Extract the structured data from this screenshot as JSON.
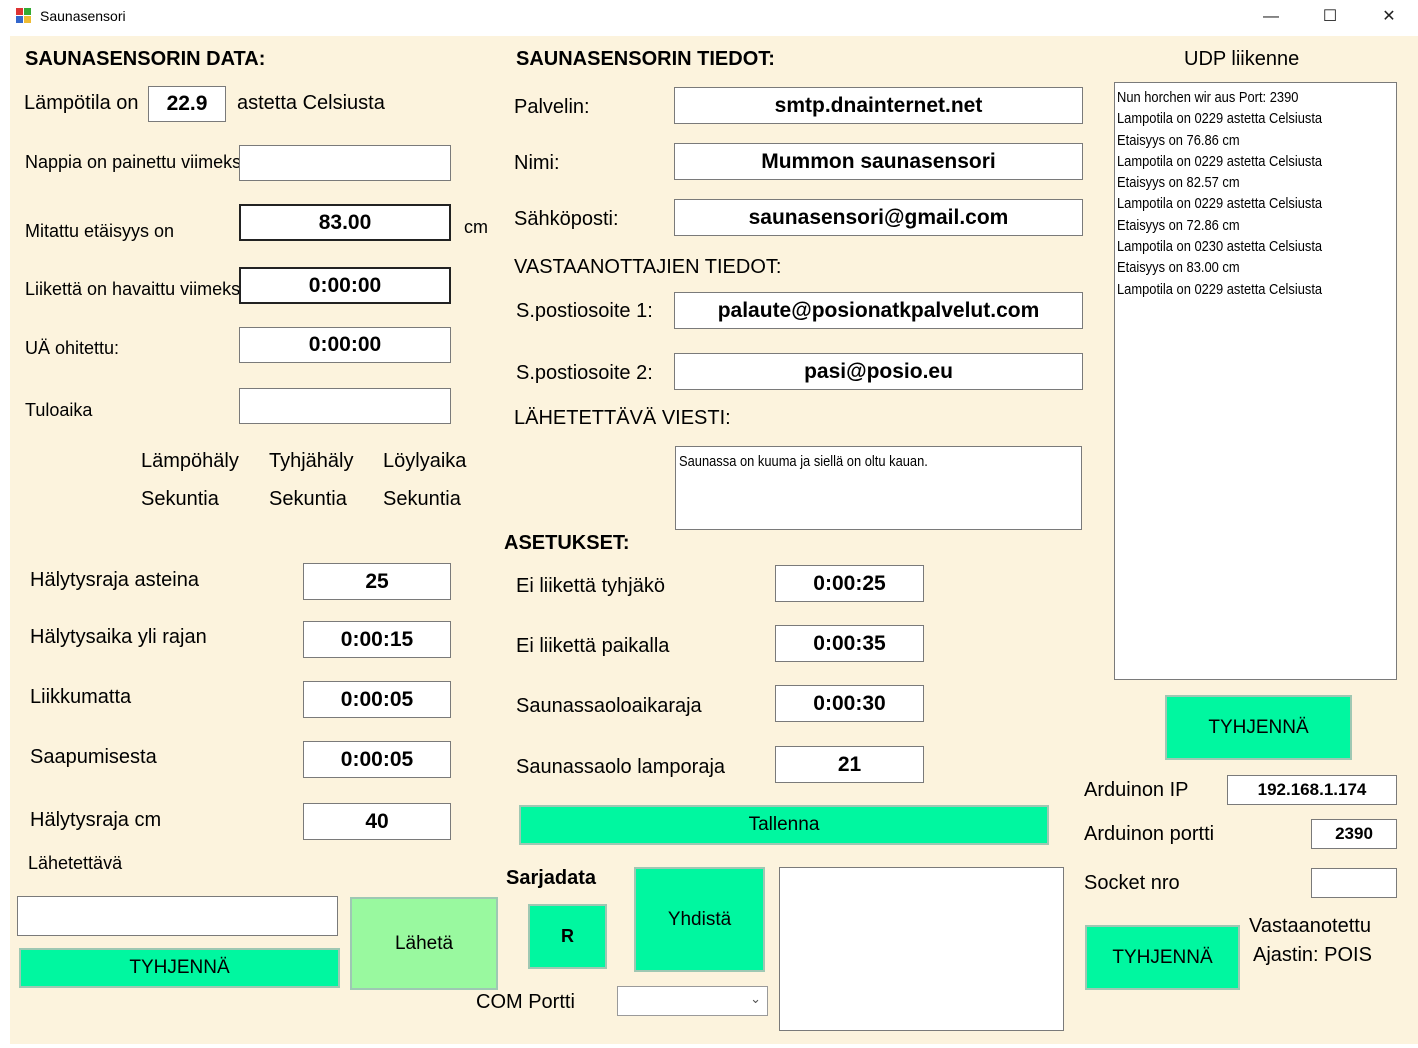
{
  "window": {
    "title": "Saunasensori",
    "minimize": "—",
    "maximize": "☐",
    "close": "✕"
  },
  "data_section": {
    "header": "SAUNASENSORIN DATA:",
    "temp_label": "Lämpötila on",
    "temp_value": "22.9",
    "temp_unit": "astetta Celsiusta",
    "button_pressed_label": "Nappia on painettu viimeksi",
    "button_pressed_value": "",
    "distance_label": "Mitattu etäisyys on",
    "distance_value": "83.00",
    "distance_unit": "cm",
    "motion_label": "Liikettä on havaittu viimeksi",
    "motion_value": "0:00:00",
    "ua_label": "UÄ ohitettu:",
    "ua_value": "0:00:00",
    "arrival_label": "Tuloaika",
    "arrival_value": "",
    "col_heat_alarm": "Lämpöhäly",
    "col_empty_alarm": "Tyhjähäly",
    "col_steam_time": "Löylyaika",
    "col_unit1": "Sekuntia",
    "col_unit2": "Sekuntia",
    "col_unit3": "Sekuntia"
  },
  "alarm_settings": {
    "temp_limit_label": "Hälytysraja asteina",
    "temp_limit_value": "25",
    "time_over_label": "Hälytysaika yli rajan",
    "time_over_value": "0:00:15",
    "still_label": "Liikkumatta",
    "still_value": "0:00:05",
    "arrival_label": "Saapumisesta",
    "arrival_value": "0:00:05",
    "cm_limit_label": "Hälytysraja cm",
    "cm_limit_value": "40",
    "send_label": "Lähetettävä",
    "send_value": "",
    "clear_button": "TYHJENNÄ",
    "send_button": "Lähetä"
  },
  "info_section": {
    "header": "SAUNASENSORIN TIEDOT:",
    "server_label": "Palvelin:",
    "server_value": "smtp.dnainternet.net",
    "name_label": "Nimi:",
    "name_value": "Mummon saunasensori",
    "email_label": "Sähköposti:",
    "email_value": "saunasensori@gmail.com",
    "recipients_header": "VASTAANOTTAJIEN TIEDOT:",
    "addr1_label": "S.postiosoite 1:",
    "addr1_value": "palaute@posionatkpalvelut.com",
    "addr2_label": "S.postiosoite 2:",
    "addr2_value": "pasi@posio.eu",
    "message_label": "LÄHETETTÄVÄ VIESTI:",
    "message_value": "Saunassa on kuuma ja siellä on oltu kauan."
  },
  "settings": {
    "header": "ASETUKSET:",
    "empty_label": "Ei liikettä tyhjäkö",
    "empty_value": "0:00:25",
    "inplace_label": "Ei liikettä paikalla",
    "inplace_value": "0:00:35",
    "stay_label": "Saunassaoloaikaraja",
    "stay_value": "0:00:30",
    "templimit_label": "Saunassaolo lamporaja",
    "templimit_value": "21",
    "save_button": "Tallenna"
  },
  "serial": {
    "header": "Sarjadata",
    "r_button": "R",
    "connect_button": "Yhdistä",
    "port_label": "COM Portti",
    "port_value": ""
  },
  "udp": {
    "header": "UDP liikenne",
    "lines": [
      "Nun horchen wir aus Port: 2390",
      "Lampotila on 0229 astetta Celsiusta",
      "Etaisyys on 76.86 cm",
      "Lampotila on 0229 astetta Celsiusta",
      "Etaisyys on 82.57 cm",
      "Lampotila on 0229 astetta Celsiusta",
      "Etaisyys on 72.86 cm",
      "Lampotila on 0230 astetta Celsiusta",
      "Etaisyys on 83.00 cm",
      "Lampotila on 0229 astetta Celsiusta"
    ],
    "clear_button": "TYHJENNÄ",
    "ip_label": "Arduinon IP",
    "ip_value": "192.168.1.174",
    "port_label": "Arduinon portti",
    "port_value": "2390",
    "socket_label": "Socket nro",
    "socket_value": "",
    "clear_button2": "TYHJENNÄ",
    "received_label": "Vastaanotettu",
    "timer_label": "Ajastin: POIS"
  }
}
